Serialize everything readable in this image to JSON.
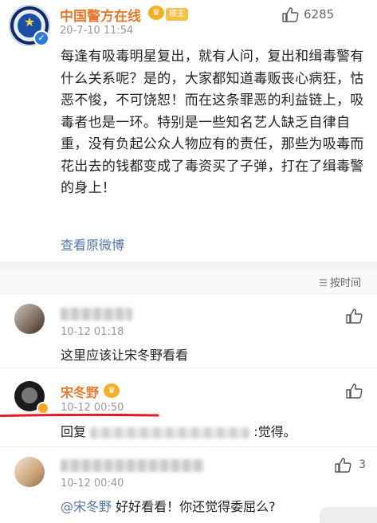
{
  "post": {
    "author": "中国警方在线",
    "badge": "楼主",
    "time": "20-7-10 11:54",
    "like_count": "6285",
    "body": "每逢有吸毒明星复出，就有人问，复出和缉毒警有什么关系呢？是的，大家都知道毒贩丧心病狂，怙恶不悛，不可饶恕！而在这条罪恶的利益链上，吸毒者也是一环。特别是一些知名艺人缺乏自律自重，没有负起公众人物应有的责任，那些为吸毒而花出去的钱都变成了毒资买了子弹，打在了缉毒警的身上！",
    "view_original": "查看原微博"
  },
  "comments_header": {
    "sort_label": "按时间"
  },
  "comments": [
    {
      "name": "",
      "time": "10-12 01:18",
      "text": "这里应该让宋冬野看看",
      "like_count": ""
    },
    {
      "name": "宋冬野",
      "time": "10-12 00:50",
      "reply_prefix": "回复",
      "reply_suffix": ":觉得。",
      "like_count": ""
    },
    {
      "name": "",
      "time": "10-12 00:40",
      "mention": "@宋冬野",
      "text": " 好好看看！你还觉得委屈么?",
      "like_count": "3"
    }
  ],
  "colors": {
    "author_orange": "#e57a2e",
    "link_blue": "#5575a8",
    "highlight_red": "#e21b2c"
  },
  "icons": {
    "like": "thumb-up-icon",
    "sort": "sort-lines-icon",
    "verified": "verified-check-icon",
    "crown": "crown-icon"
  }
}
